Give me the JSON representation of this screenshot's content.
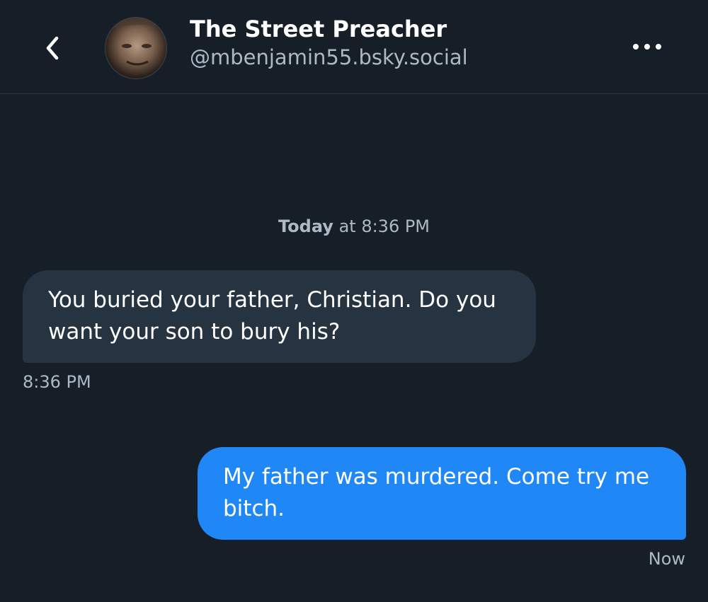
{
  "header": {
    "back_icon": "chevron-left-icon",
    "display_name": "The Street Preacher",
    "handle": "@mbenjamin55.bsky.social",
    "more_icon": "ellipsis-horizontal-icon"
  },
  "day_separator": {
    "day": "Today",
    "rest": " at 8:36 PM"
  },
  "messages": [
    {
      "direction": "incoming",
      "text": "You buried your father, Christian. Do you want your son to bury his?",
      "time": "8:36 PM"
    },
    {
      "direction": "outgoing",
      "text": "My father was murdered. Come try me bitch.",
      "time": "Now"
    }
  ],
  "colors": {
    "background": "#161e27",
    "incoming_bubble": "#263341",
    "outgoing_bubble": "#1f88f6",
    "secondary_text": "#aeb9c6"
  }
}
